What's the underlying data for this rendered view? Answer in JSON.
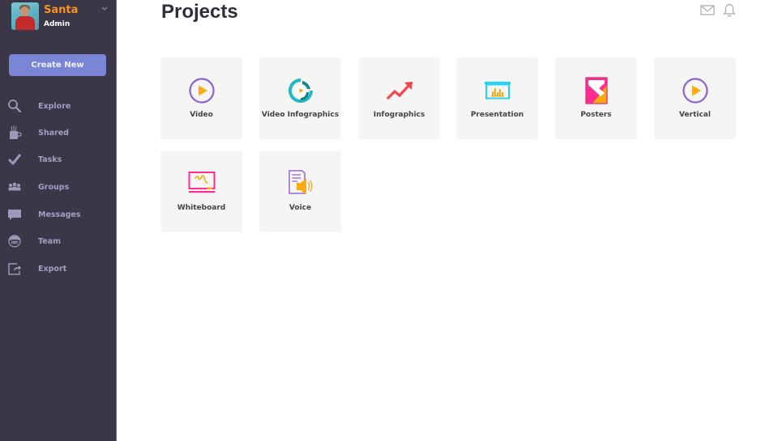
{
  "profile": {
    "name": "Santa",
    "role": "Admin",
    "avatar_icon": "user-photo"
  },
  "sidebar": {
    "create_button": "Create New",
    "items": [
      {
        "label": "Explore",
        "icon": "search-icon"
      },
      {
        "label": "Shared",
        "icon": "shared-cup-icon"
      },
      {
        "label": "Tasks",
        "icon": "check-icon"
      },
      {
        "label": "Groups",
        "icon": "groups-icon"
      },
      {
        "label": "Messages",
        "icon": "message-bubble-icon"
      },
      {
        "label": "Team",
        "icon": "team-icon"
      },
      {
        "label": "Export",
        "icon": "export-icon"
      }
    ]
  },
  "header": {
    "title": "Projects",
    "icons": [
      "mail-icon",
      "bell-icon"
    ]
  },
  "projects": [
    {
      "label": "Video",
      "icon": "video-play-icon"
    },
    {
      "label": "Video Infographics",
      "icon": "video-infographics-icon"
    },
    {
      "label": "Infographics",
      "icon": "trend-arrow-icon"
    },
    {
      "label": "Presentation",
      "icon": "presentation-icon"
    },
    {
      "label": "Posters",
      "icon": "poster-icon"
    },
    {
      "label": "Vertical",
      "icon": "vertical-play-icon"
    },
    {
      "label": "Whiteboard",
      "icon": "whiteboard-icon"
    },
    {
      "label": "Voice",
      "icon": "voice-icon"
    }
  ],
  "colors": {
    "sidebar_bg": "#3b3748",
    "accent_button": "#7b85d6",
    "profile_name": "#f7931e",
    "nav_text": "#a39fc2",
    "card_bg": "#f5f5f5",
    "purple": "#8c63d6",
    "orange": "#fcaa0f",
    "teal": "#1fb8c4",
    "red": "#f4454f",
    "cyan": "#23d3f5",
    "pink": "#ff2d8f"
  }
}
